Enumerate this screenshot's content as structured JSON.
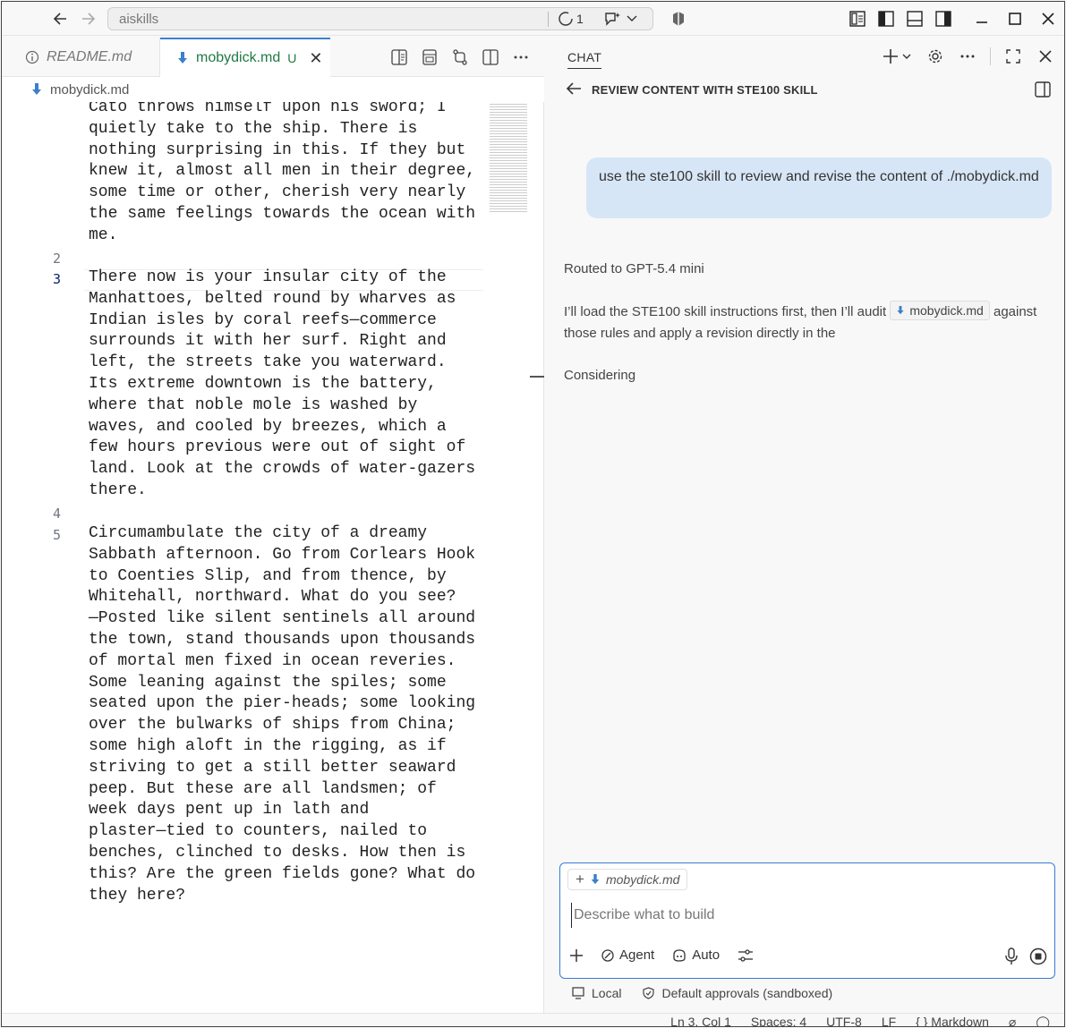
{
  "titlebar": {
    "search_text": "aiskills",
    "progress_count": "1"
  },
  "editor": {
    "tabs": [
      {
        "label": "README.md"
      },
      {
        "label": "mobydick.md",
        "status": "U"
      }
    ],
    "breadcrumb": "mobydick.md",
    "line_numbers": [
      "2",
      "3",
      "4",
      "5"
    ],
    "paragraphs": [
      "Cato throws himself upon his sword; I\nquietly take to the ship. There is\nnothing surprising in this. If they but\nknew it, almost all men in their degree,\nsome time or other, cherish very nearly\nthe same feelings towards the ocean with\nme.",
      "There now is your insular city of the\nManhattoes, belted round by wharves as\nIndian isles by coral reefs—commerce\nsurrounds it with her surf. Right and\nleft, the streets take you waterward.\nIts extreme downtown is the battery,\nwhere that noble mole is washed by\nwaves, and cooled by breezes, which a\nfew hours previous were out of sight of\nland. Look at the crowds of water-gazers\nthere.",
      "Circumambulate the city of a dreamy\nSabbath afternoon. Go from Corlears Hook\nto Coenties Slip, and from thence, by\nWhitehall, northward. What do you see?\n—Posted like silent sentinels all around\nthe town, stand thousands upon thousands\nof mortal men fixed in ocean reveries.\nSome leaning against the spiles; some\nseated upon the pier-heads; some looking\nover the bulwarks of ships from China;\nsome high aloft in the rigging, as if\nstriving to get a still better seaward\npeep. But these are all landsmen; of\nweek days pent up in lath and\nplaster—tied to counters, nailed to\nbenches, clinched to desks. How then is\nthis? Are the green fields gone? What do\nthey here?"
    ]
  },
  "chat": {
    "tab_label": "CHAT",
    "session_title": "REVIEW CONTENT WITH STE100 SKILL",
    "user_message": "use the ste100 skill to review and revise the content of ./mobydick.md",
    "routed": "Routed to GPT-5.4 mini",
    "assistant_before": "I’ll load the STE100 skill instructions first, then I’ll audit ",
    "assistant_chip": "mobydick.md",
    "assistant_after": " against those rules and apply a revision directly in the",
    "status": "Considering",
    "input": {
      "attachment": "mobydick.md",
      "placeholder": "Describe what to build",
      "mode": "Agent",
      "model": "Auto"
    },
    "footer": {
      "location": "Local",
      "approvals": "Default approvals (sandboxed)"
    }
  },
  "statusbar": {
    "position": "Ln 3, Col 1",
    "spaces": "Spaces: 4",
    "encoding": "UTF-8",
    "eol": "LF",
    "language": "Markdown"
  },
  "colors": {
    "accent": "#3a7bd5",
    "modified_tab": "#1f7a42",
    "user_bubble": "#d7e6f7"
  }
}
